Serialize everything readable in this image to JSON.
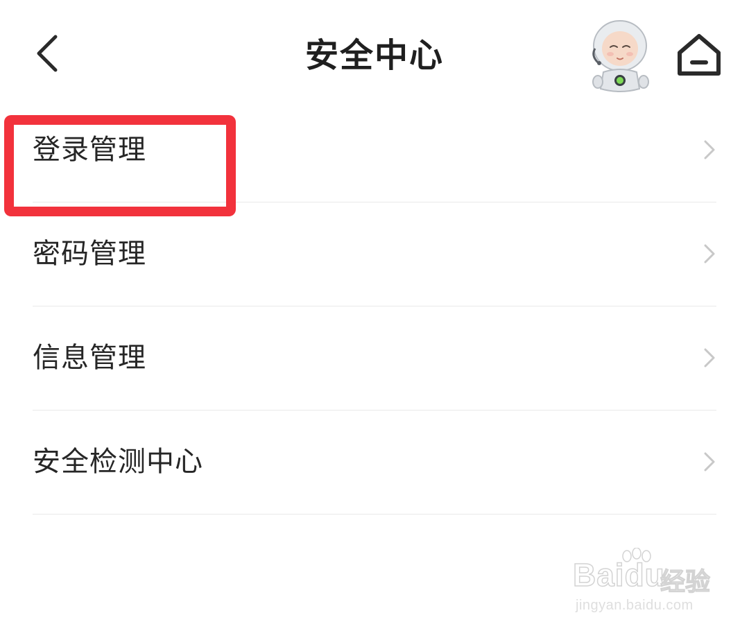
{
  "header": {
    "title": "安全中心",
    "back_icon": "chevron-left-icon",
    "mascot": "astronaut-mascot",
    "home_icon": "home-icon"
  },
  "menu": {
    "items": [
      {
        "label": "登录管理",
        "icon": "chevron-right-icon",
        "highlighted": true
      },
      {
        "label": "密码管理",
        "icon": "chevron-right-icon"
      },
      {
        "label": "信息管理",
        "icon": "chevron-right-icon"
      },
      {
        "label": "安全检测中心",
        "icon": "chevron-right-icon"
      }
    ]
  },
  "watermark": {
    "logo": "Baidu",
    "suffix": "经验",
    "url": "jingyan.baidu.com"
  },
  "colors": {
    "highlight": "#f2323c",
    "text": "#262626",
    "divider": "#e9e9e9",
    "chevron": "#c8c8c8"
  }
}
